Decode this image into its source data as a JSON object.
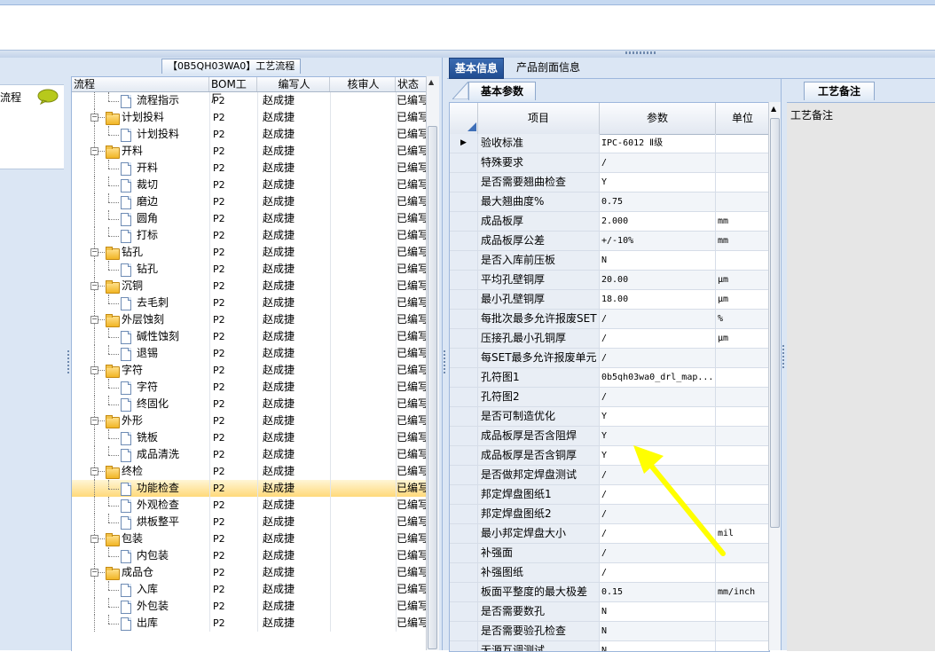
{
  "left_panel": {
    "item_label": "流程"
  },
  "flow_panel": {
    "tab_label": "【0B5QH03WA0】工艺流程",
    "columns": [
      "流程",
      "BOM工厂",
      "编写人",
      "核审人",
      "状态"
    ],
    "rows": [
      {
        "name": "流程指示",
        "level": 2,
        "type": "doc",
        "bom": "P2",
        "writer": "赵成捷",
        "status": "已编写"
      },
      {
        "name": "计划投料",
        "level": 1,
        "type": "folder",
        "bom": "P2",
        "writer": "赵成捷",
        "status": "已编写"
      },
      {
        "name": "计划投料",
        "level": 2,
        "type": "doc",
        "bom": "P2",
        "writer": "赵成捷",
        "status": "已编写"
      },
      {
        "name": "开料",
        "level": 1,
        "type": "folder",
        "bom": "P2",
        "writer": "赵成捷",
        "status": "已编写"
      },
      {
        "name": "开料",
        "level": 2,
        "type": "doc",
        "bom": "P2",
        "writer": "赵成捷",
        "status": "已编写"
      },
      {
        "name": "裁切",
        "level": 2,
        "type": "doc",
        "bom": "P2",
        "writer": "赵成捷",
        "status": "已编写"
      },
      {
        "name": "磨边",
        "level": 2,
        "type": "doc",
        "bom": "P2",
        "writer": "赵成捷",
        "status": "已编写"
      },
      {
        "name": "圆角",
        "level": 2,
        "type": "doc",
        "bom": "P2",
        "writer": "赵成捷",
        "status": "已编写"
      },
      {
        "name": "打标",
        "level": 2,
        "type": "doc",
        "bom": "P2",
        "writer": "赵成捷",
        "status": "已编写"
      },
      {
        "name": "钻孔",
        "level": 1,
        "type": "folder",
        "bom": "P2",
        "writer": "赵成捷",
        "status": "已编写"
      },
      {
        "name": "钻孔",
        "level": 2,
        "type": "doc",
        "bom": "P2",
        "writer": "赵成捷",
        "status": "已编写"
      },
      {
        "name": "沉铜",
        "level": 1,
        "type": "folder",
        "bom": "P2",
        "writer": "赵成捷",
        "status": "已编写"
      },
      {
        "name": "去毛刺",
        "level": 2,
        "type": "doc",
        "bom": "P2",
        "writer": "赵成捷",
        "status": "已编写"
      },
      {
        "name": "外层蚀刻",
        "level": 1,
        "type": "folder",
        "bom": "P2",
        "writer": "赵成捷",
        "status": "已编写"
      },
      {
        "name": "碱性蚀刻",
        "level": 2,
        "type": "doc",
        "bom": "P2",
        "writer": "赵成捷",
        "status": "已编写"
      },
      {
        "name": "退锡",
        "level": 2,
        "type": "doc",
        "bom": "P2",
        "writer": "赵成捷",
        "status": "已编写"
      },
      {
        "name": "字符",
        "level": 1,
        "type": "folder",
        "bom": "P2",
        "writer": "赵成捷",
        "status": "已编写"
      },
      {
        "name": "字符",
        "level": 2,
        "type": "doc",
        "bom": "P2",
        "writer": "赵成捷",
        "status": "已编写"
      },
      {
        "name": "终固化",
        "level": 2,
        "type": "doc",
        "bom": "P2",
        "writer": "赵成捷",
        "status": "已编写"
      },
      {
        "name": "外形",
        "level": 1,
        "type": "folder",
        "bom": "P2",
        "writer": "赵成捷",
        "status": "已编写"
      },
      {
        "name": "铣板",
        "level": 2,
        "type": "doc",
        "bom": "P2",
        "writer": "赵成捷",
        "status": "已编写"
      },
      {
        "name": "成品清洗",
        "level": 2,
        "type": "doc",
        "bom": "P2",
        "writer": "赵成捷",
        "status": "已编写"
      },
      {
        "name": "终检",
        "level": 1,
        "type": "folder",
        "bom": "P2",
        "writer": "赵成捷",
        "status": "已编写"
      },
      {
        "name": "功能检查",
        "level": 2,
        "type": "doc",
        "bom": "P2",
        "writer": "赵成捷",
        "status": "已编写",
        "selected": true
      },
      {
        "name": "外观检查",
        "level": 2,
        "type": "doc",
        "bom": "P2",
        "writer": "赵成捷",
        "status": "已编写"
      },
      {
        "name": "烘板整平",
        "level": 2,
        "type": "doc",
        "bom": "P2",
        "writer": "赵成捷",
        "status": "已编写"
      },
      {
        "name": "包装",
        "level": 1,
        "type": "folder",
        "bom": "P2",
        "writer": "赵成捷",
        "status": "已编写"
      },
      {
        "name": "内包装",
        "level": 2,
        "type": "doc",
        "bom": "P2",
        "writer": "赵成捷",
        "status": "已编写"
      },
      {
        "name": "成品仓",
        "level": 1,
        "type": "folder",
        "bom": "P2",
        "writer": "赵成捷",
        "status": "已编写"
      },
      {
        "name": "入库",
        "level": 2,
        "type": "doc",
        "bom": "P2",
        "writer": "赵成捷",
        "status": "已编写"
      },
      {
        "name": "外包装",
        "level": 2,
        "type": "doc",
        "bom": "P2",
        "writer": "赵成捷",
        "status": "已编写"
      },
      {
        "name": "出库",
        "level": 2,
        "type": "doc",
        "bom": "P2",
        "writer": "赵成捷",
        "status": "已编写"
      }
    ]
  },
  "main_tabs": [
    "基本信息",
    "产品剖面信息"
  ],
  "param_panel": {
    "subtab": "基本参数",
    "columns": [
      "项目",
      "参数",
      "单位"
    ],
    "current_row_marker": "▶",
    "rows": [
      {
        "item": "验收标准",
        "value": "IPC-6012 Ⅱ级",
        "unit": ""
      },
      {
        "item": "特殊要求",
        "value": "/",
        "unit": ""
      },
      {
        "item": "是否需要翘曲检查",
        "value": "Y",
        "unit": ""
      },
      {
        "item": "最大翘曲度%",
        "value": "0.75",
        "unit": ""
      },
      {
        "item": "成品板厚",
        "value": "2.000",
        "unit": "mm"
      },
      {
        "item": "成品板厚公差",
        "value": "+/-10%",
        "unit": "mm"
      },
      {
        "item": "是否入库前压板",
        "value": "N",
        "unit": ""
      },
      {
        "item": "平均孔壁铜厚",
        "value": "20.00",
        "unit": "μm"
      },
      {
        "item": "最小孔壁铜厚",
        "value": "18.00",
        "unit": "μm"
      },
      {
        "item": "每批次最多允许报废SET",
        "value": "/",
        "unit": "%"
      },
      {
        "item": "压接孔最小孔铜厚",
        "value": "/",
        "unit": "μm"
      },
      {
        "item": "每SET最多允许报废单元",
        "value": "/",
        "unit": ""
      },
      {
        "item": "孔符图1",
        "value": "0b5qh03wa0_drl_map...",
        "unit": ""
      },
      {
        "item": "孔符图2",
        "value": "/",
        "unit": ""
      },
      {
        "item": "是否可制造优化",
        "value": "Y",
        "unit": ""
      },
      {
        "item": "成品板厚是否含阻焊",
        "value": "Y",
        "unit": ""
      },
      {
        "item": "成品板厚是否含铜厚",
        "value": "Y",
        "unit": ""
      },
      {
        "item": "是否做邦定焊盘测试",
        "value": "/",
        "unit": ""
      },
      {
        "item": "邦定焊盘图纸1",
        "value": "/",
        "unit": ""
      },
      {
        "item": "邦定焊盘图纸2",
        "value": "/",
        "unit": ""
      },
      {
        "item": "最小邦定焊盘大小",
        "value": "/",
        "unit": "mil"
      },
      {
        "item": "补强面",
        "value": "/",
        "unit": ""
      },
      {
        "item": "补强图纸",
        "value": "/",
        "unit": ""
      },
      {
        "item": "板面平整度的最大极差",
        "value": "0.15",
        "unit": "mm/inch"
      },
      {
        "item": "是否需要数孔",
        "value": "N",
        "unit": ""
      },
      {
        "item": "是否需要验孔检查",
        "value": "N",
        "unit": ""
      },
      {
        "item": "无源互调测试",
        "value": "N",
        "unit": ""
      }
    ]
  },
  "notes_panel": {
    "tab": "工艺备注",
    "label": "工艺备注"
  },
  "colors": {
    "accent": "#1f4c91",
    "selection": "#ffd97a",
    "arrow": "#ffff00"
  }
}
